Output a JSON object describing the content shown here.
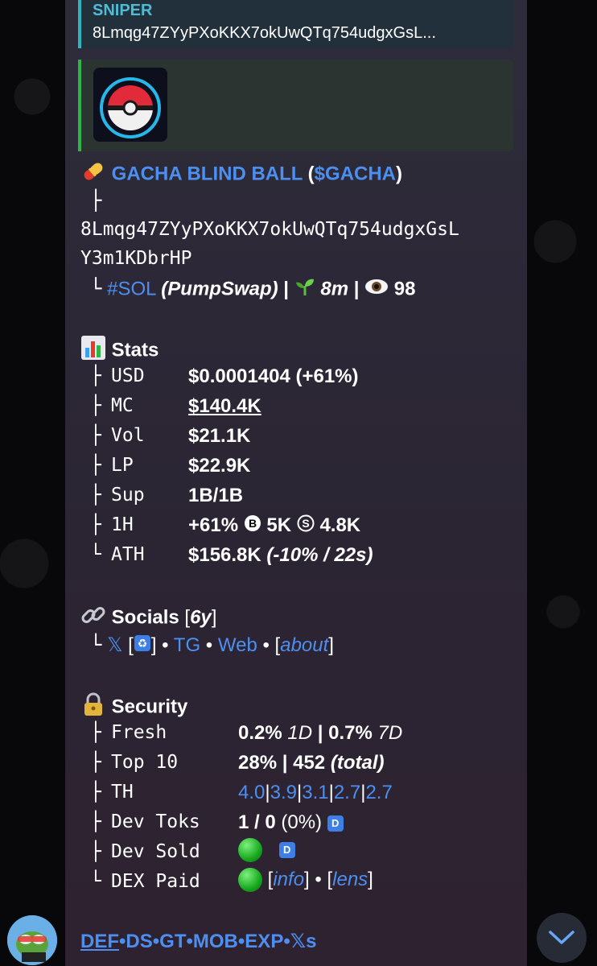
{
  "reply": {
    "sender": "SNIPER",
    "text": "8Lmqg47ZYyPXoKKX7okUwQTq754udgxGsL..."
  },
  "token": {
    "name": "GACHA BLIND BALL",
    "ticker": "$GACHA",
    "address_line1": "8Lmqg47ZYyPXoKKX7okUwQTq754udgxGsL",
    "address_line2": "Y3m1KDbrHP",
    "chain": "#SOL",
    "dex": "(PumpSwap)",
    "age": "8m",
    "views": "98"
  },
  "stats": {
    "title": "Stats",
    "usd_label": "USD",
    "usd_value": "$0.0001404 (+61%)",
    "mc_label": "MC",
    "mc_value": "$140.4K",
    "vol_label": "Vol",
    "vol_value": "$21.1K",
    "lp_label": "LP",
    "lp_value": "$22.9K",
    "sup_label": "Sup",
    "sup_value": "1B/1B",
    "h1_label": "1H",
    "h1_change": "+61%",
    "h1_buy": "5K",
    "h1_sell": "4.8K",
    "ath_label": "ATH",
    "ath_value": "$156.8K",
    "ath_detail": "(-10% / 22s)"
  },
  "socials": {
    "title": "Socials",
    "age": "6y",
    "x": "𝕏",
    "tg": "TG",
    "web": "Web",
    "about": "about"
  },
  "security": {
    "title": "Security",
    "fresh_label": "Fresh",
    "fresh_1d": "0.2%",
    "fresh_1d_tag": "1D",
    "fresh_7d": "0.7%",
    "fresh_7d_tag": "7D",
    "top10_label": "Top 10",
    "top10_pct": "28%",
    "top10_total": "452",
    "top10_tag": "(total)",
    "th_label": "TH",
    "th_values": [
      "4.0",
      "3.9",
      "3.1",
      "2.7",
      "2.7"
    ],
    "devtoks_label": "Dev Toks",
    "devtoks_value": "1 / 0",
    "devtoks_pct": "(0%)",
    "devsold_label": "Dev Sold",
    "dexpaid_label": "DEX Paid",
    "dexpaid_info": "info",
    "dexpaid_lens": "lens"
  },
  "footer_links": [
    "DEF",
    "DS",
    "GT",
    "MOB",
    "EXP",
    "𝕏s"
  ],
  "colors": {
    "link": "#4d8ff0",
    "accent_green": "#2fb543",
    "reply_accent": "#2fb5c2"
  }
}
